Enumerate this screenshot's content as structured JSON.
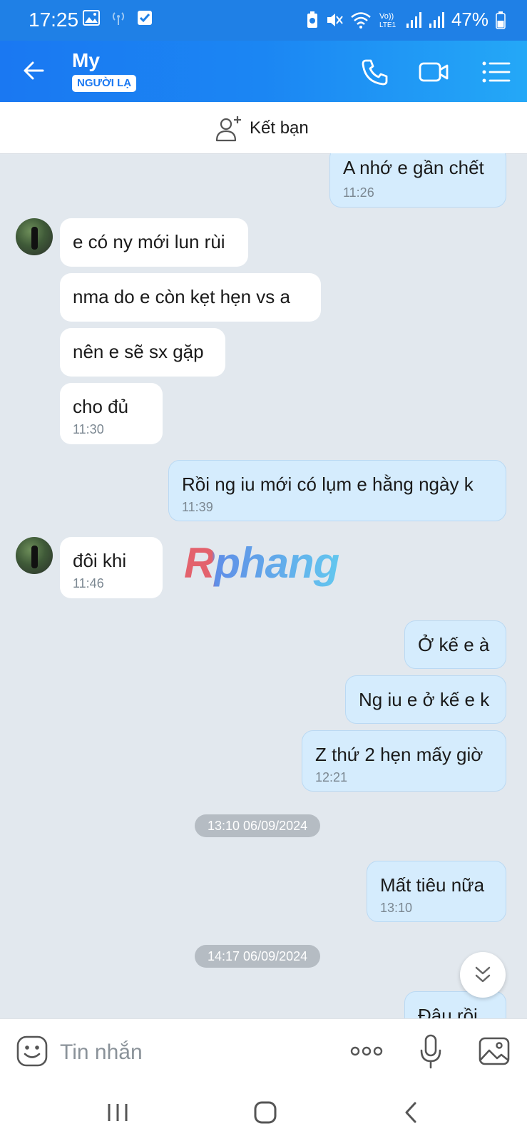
{
  "status_bar": {
    "time": "17:25",
    "battery": "47%",
    "icons": [
      "gallery-icon",
      "hotspot-icon",
      "checkbox-icon",
      "battery-saver-icon",
      "mute-icon",
      "wifi-icon",
      "volte-icon",
      "signal-icon",
      "signal-icon",
      "battery-icon"
    ]
  },
  "header": {
    "contact_name": "My",
    "tag": "NGƯỜI LẠ",
    "buttons": [
      "back-arrow-icon",
      "phone-icon",
      "video-camera-icon",
      "menu-list-icon"
    ]
  },
  "friend_bar": {
    "label": "Kết bạn"
  },
  "messages": [
    {
      "side": "out",
      "text": "A nhớ e gần chết",
      "time": "11:26"
    },
    {
      "side": "in",
      "text": "e có ny mới lun rùi"
    },
    {
      "side": "in",
      "text": "nma do e còn kẹt hẹn vs a"
    },
    {
      "side": "in",
      "text": "nên e sẽ sx gặp"
    },
    {
      "side": "in",
      "text": "cho đủ",
      "time": "11:30"
    },
    {
      "side": "out",
      "text": "Rồi ng iu mới có lụm e hằng ngày k",
      "time": "11:39"
    },
    {
      "side": "in",
      "text": "đôi khi",
      "time": "11:46"
    },
    {
      "side": "out",
      "text": "Ở kế e à"
    },
    {
      "side": "out",
      "text": "Ng iu e ở kế e k"
    },
    {
      "side": "out",
      "text": "Z thứ 2 hẹn mấy giờ",
      "time": "12:21"
    },
    {
      "side": "out",
      "text": "Mất tiêu nữa",
      "time": "13:10"
    },
    {
      "side": "out",
      "text": "Đâu rồi"
    }
  ],
  "date_separators": [
    "13:10 06/09/2024",
    "14:17 06/09/2024"
  ],
  "watermark": "Rphang",
  "input": {
    "placeholder": "Tin nhắn",
    "value": ""
  },
  "colors": {
    "primary": "#1a78f2",
    "outgoing_bubble": "#d5ecfd",
    "incoming_bubble": "#ffffff",
    "chat_bg": "#e2e8ee"
  }
}
